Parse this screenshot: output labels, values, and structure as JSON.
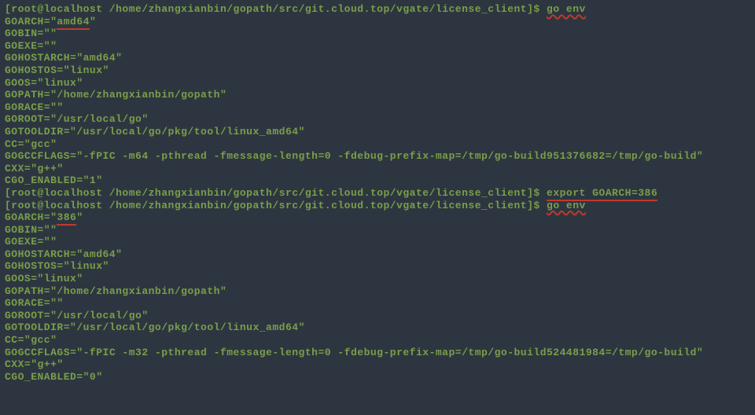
{
  "terminal": {
    "prompt1": {
      "user_host": "[root@localhost ",
      "path": "/home/zhangxianbin/gopath/src/git.cloud.top/vgate/license_client",
      "end": "]$ ",
      "cmd": "go env"
    },
    "env1": {
      "l1a": "GOARCH=\"",
      "l1b": "amd64",
      "l1c": "\"",
      "l2": "GOBIN=\"\"",
      "l3": "GOEXE=\"\"",
      "l4": "GOHOSTARCH=\"amd64\"",
      "l5": "GOHOSTOS=\"linux\"",
      "l6": "GOOS=\"linux\"",
      "l7": "GOPATH=\"/home/zhangxianbin/gopath\"",
      "l8": "GORACE=\"\"",
      "l9": "GOROOT=\"/usr/local/go\"",
      "l10": "GOTOOLDIR=\"/usr/local/go/pkg/tool/linux_amd64\"",
      "l11": "CC=\"gcc\"",
      "l12": "GOGCCFLAGS=\"-fPIC -m64 -pthread -fmessage-length=0 -fdebug-prefix-map=/tmp/go-build951376682=/tmp/go-build\"",
      "l13": "CXX=\"g++\"",
      "l14": "CGO_ENABLED=\"1\""
    },
    "prompt2": {
      "user_host": "[root@localhost ",
      "path": "/home/zhangxianbin/gopath/src/git.cloud.top/vgate/license_client",
      "end": "]$ ",
      "cmd": "export GOARCH=386"
    },
    "prompt3": {
      "user_host": "[root@localhost ",
      "path": "/home/zhangxianbin/gopath/src/git.cloud.top/vgate/license_client",
      "end": "]$ ",
      "cmd": "go env"
    },
    "env2": {
      "l1a": "GOARCH=\"",
      "l1b": "386",
      "l1c": "\"",
      "l2": "GOBIN=\"\"",
      "l3": "GOEXE=\"\"",
      "l4": "GOHOSTARCH=\"amd64\"",
      "l5": "GOHOSTOS=\"linux\"",
      "l6": "GOOS=\"linux\"",
      "l7": "GOPATH=\"/home/zhangxianbin/gopath\"",
      "l8": "GORACE=\"\"",
      "l9": "GOROOT=\"/usr/local/go\"",
      "l10": "GOTOOLDIR=\"/usr/local/go/pkg/tool/linux_amd64\"",
      "l11": "CC=\"gcc\"",
      "l12": "GOGCCFLAGS=\"-fPIC -m32 -pthread -fmessage-length=0 -fdebug-prefix-map=/tmp/go-build524481984=/tmp/go-build\"",
      "l13": "CXX=\"g++\"",
      "l14": "CGO_ENABLED=\"0\""
    }
  }
}
